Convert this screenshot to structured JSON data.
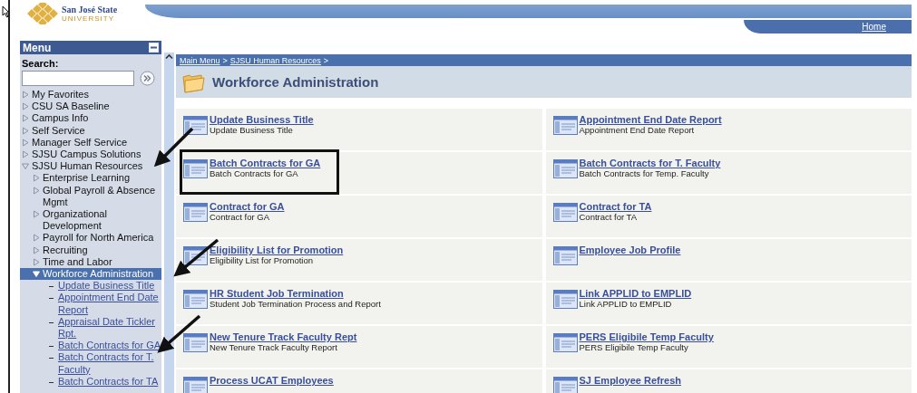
{
  "logo": {
    "name": "San José State",
    "subtitle": "UNIVERSITY"
  },
  "header": {
    "home_link": "Home"
  },
  "menu": {
    "title": "Menu",
    "search_label": "Search:",
    "items": [
      {
        "label": "My Favorites",
        "kind": "folder",
        "expanded": false,
        "selected": false
      },
      {
        "label": "CSU SA Baseline",
        "kind": "folder",
        "expanded": false,
        "selected": false
      },
      {
        "label": "Campus Info",
        "kind": "folder",
        "expanded": false,
        "selected": false
      },
      {
        "label": "Self Service",
        "kind": "folder",
        "expanded": false,
        "selected": false
      },
      {
        "label": "Manager Self Service",
        "kind": "folder",
        "expanded": false,
        "selected": false
      },
      {
        "label": "SJSU Campus Solutions",
        "kind": "folder",
        "expanded": false,
        "selected": false
      },
      {
        "label": "SJSU Human Resources",
        "kind": "folder",
        "expanded": true,
        "selected": false,
        "children": [
          {
            "label": "Enterprise Learning",
            "kind": "folder",
            "expanded": false,
            "selected": false
          },
          {
            "label": "Global Payroll & Absence Mgmt",
            "kind": "folder",
            "expanded": false,
            "selected": false
          },
          {
            "label": "Organizational Development",
            "kind": "folder",
            "expanded": false,
            "selected": false
          },
          {
            "label": "Payroll for North America",
            "kind": "folder",
            "expanded": false,
            "selected": false
          },
          {
            "label": "Recruiting",
            "kind": "folder",
            "expanded": false,
            "selected": false
          },
          {
            "label": "Time and Labor",
            "kind": "folder",
            "expanded": false,
            "selected": false
          },
          {
            "label": "Workforce Administration",
            "kind": "folder",
            "expanded": true,
            "selected": true,
            "children": [
              {
                "label": "Update Business Title",
                "kind": "link",
                "selected": false
              },
              {
                "label": "Appointment End Date Report",
                "kind": "link",
                "selected": false
              },
              {
                "label": "Appraisal Date Tickler Rpt.",
                "kind": "link",
                "selected": false
              },
              {
                "label": "Batch Contracts for GA",
                "kind": "link",
                "selected": false
              },
              {
                "label": "Batch Contracts for T. Faculty",
                "kind": "link",
                "selected": false
              },
              {
                "label": "Batch Contracts for TA",
                "kind": "link",
                "selected": false
              }
            ]
          }
        ]
      }
    ]
  },
  "breadcrumb": {
    "items": [
      "Main Menu",
      "SJSU Human Resources"
    ],
    "separator": ">"
  },
  "page": {
    "title": "Workforce Administration"
  },
  "tiles": [
    {
      "title": "Update Business Title",
      "description": "Update Business Title",
      "highlighted": false
    },
    {
      "title": "Appointment End Date Report",
      "description": "Appointment End Date Report",
      "highlighted": false
    },
    {
      "title": "Batch Contracts for GA",
      "description": "Batch Contracts for GA",
      "highlighted": true
    },
    {
      "title": "Batch Contracts for T. Faculty",
      "description": "Batch Contracts for Temp. Faculty",
      "highlighted": false
    },
    {
      "title": "Contract for GA",
      "description": "Contract for GA",
      "highlighted": false
    },
    {
      "title": "Contract for TA",
      "description": "Contract for TA",
      "highlighted": false
    },
    {
      "title": "Eligibility List for Promotion",
      "description": "Eligibility List for Promotion",
      "highlighted": false
    },
    {
      "title": "Employee Job Profile",
      "highlighted": false
    },
    {
      "title": "HR Student Job Termination",
      "description": "Student Job Termination Process and Report",
      "highlighted": false
    },
    {
      "title": "Link APPLID to EMPLID",
      "description": "Link APPLID to EMPLID",
      "highlighted": false
    },
    {
      "title": "New Tenure Track Faculty Rept",
      "description": "New Tenure Track Faculty Report",
      "highlighted": false
    },
    {
      "title": "PERS Eligibile Temp Faculty",
      "description": "PERS Eligibile Temp Faculty",
      "highlighted": false
    },
    {
      "title": "Process UCAT Employees",
      "highlighted": false
    },
    {
      "title": "SJ Employee Refresh",
      "highlighted": false
    }
  ]
}
